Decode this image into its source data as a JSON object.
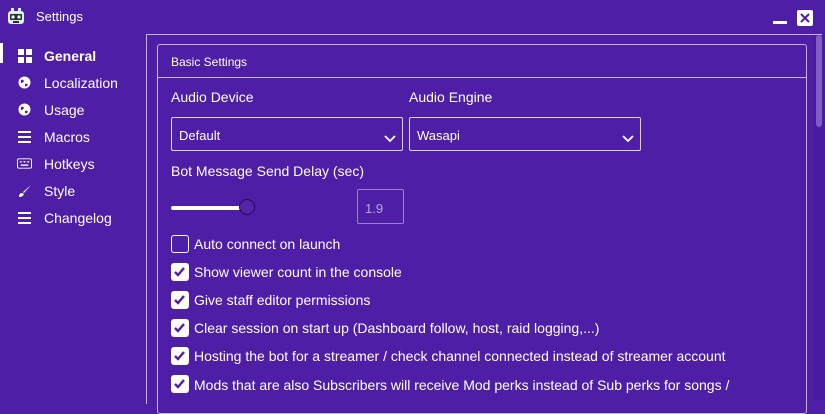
{
  "window": {
    "title": "Settings",
    "bg": "#4f1ea6"
  },
  "sidebar": {
    "items": [
      {
        "label": "General",
        "icon": "windows-icon",
        "active": true
      },
      {
        "label": "Localization",
        "icon": "globe-icon"
      },
      {
        "label": "Usage",
        "icon": "globe-icon"
      },
      {
        "label": "Macros",
        "icon": "list-icon"
      },
      {
        "label": "Hotkeys",
        "icon": "keyboard-icon"
      },
      {
        "label": "Style",
        "icon": "brush-icon"
      },
      {
        "label": "Changelog",
        "icon": "list-icon"
      }
    ]
  },
  "panel": {
    "title": "Basic Settings",
    "audio_device": {
      "label": "Audio Device",
      "value": "Default"
    },
    "audio_engine": {
      "label": "Audio Engine",
      "value": "Wasapi"
    },
    "send_delay": {
      "label": "Bot Message Send Delay (sec)",
      "value": "1.9"
    },
    "checkboxes": [
      {
        "label": "Auto connect on launch",
        "checked": false
      },
      {
        "label": "Show viewer count in the console",
        "checked": true
      },
      {
        "label": "Give staff editor permissions",
        "checked": true
      },
      {
        "label": "Clear session on start up (Dashboard follow, host, raid logging,...)",
        "checked": true
      },
      {
        "label": "Hosting the bot for a streamer / check channel connected instead of streamer account",
        "checked": true
      },
      {
        "label": "Mods that are also Subscribers will receive Mod perks instead of Sub perks for songs / minigames",
        "checked": true
      }
    ]
  }
}
